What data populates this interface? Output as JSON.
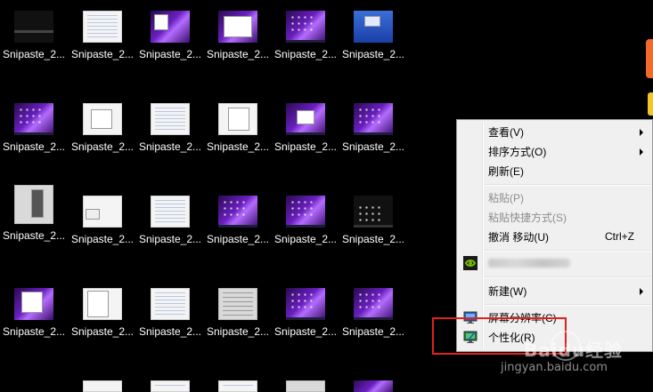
{
  "desktop": {
    "icon_label": "Snipaste_2..."
  },
  "context_menu": {
    "items": {
      "view": "查看(V)",
      "sort": "排序方式(O)",
      "refresh": "刷新(E)",
      "paste": "粘贴(P)",
      "paste_shortcut": "粘贴快捷方式(S)",
      "undo": "撤消 移动(U)",
      "undo_shortcut": "Ctrl+Z",
      "new": "新建(W)",
      "resolution": "屏幕分辨率(C)",
      "personalize": "个性化(R)"
    }
  },
  "watermark": {
    "brand": "Baidu经验",
    "url": "jingyan.baidu.com"
  },
  "colors": {
    "desktop_bg": "#000000",
    "menu_bg": "#f0f0f0",
    "highlight": "#e02020",
    "nvidia_green": "#76b900",
    "accent_orange": "#ef6a2c",
    "accent_yellow": "#f2c62a"
  }
}
